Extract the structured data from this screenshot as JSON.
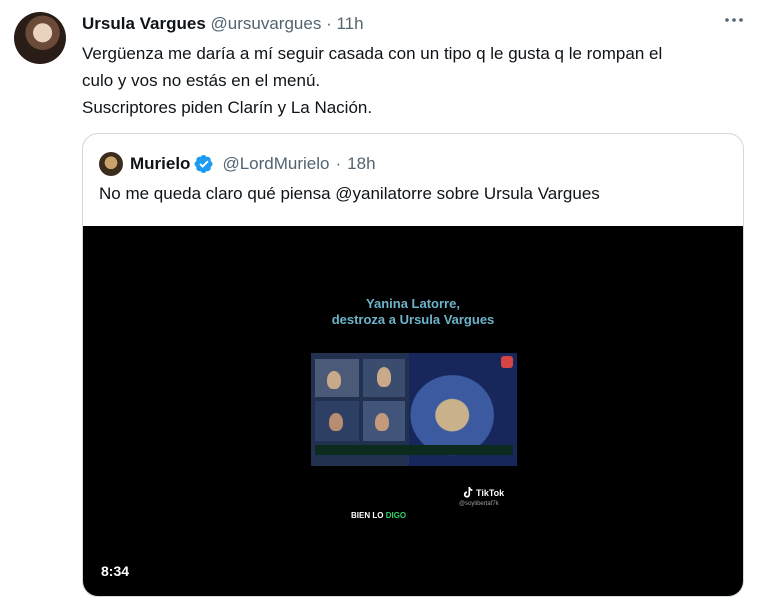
{
  "tweet": {
    "name": "Ursula Vargues",
    "handle": "@ursuvargues",
    "separator": "·",
    "time": "11h",
    "text_lines": [
      "Vergüenza me daría a mí seguir casada con un tipo q le gusta q le rompan el",
      "culo y vos no estás en el menú.",
      "Suscriptores piden Clarín y La Nación."
    ],
    "more_icon": "ellipsis-icon"
  },
  "quote": {
    "name": "Murielo",
    "handle": "@LordMurielo",
    "separator": "·",
    "time": "18h",
    "text": "No me queda claro qué piensa @yanilatorre sobre Ursula Vargues",
    "verified_icon": "verified-badge-icon"
  },
  "video": {
    "title_line1": "Yanina Latorre,",
    "title_line2": "destroza a Ursula Vargues",
    "tiktok_label": "TikTok",
    "tiktok_user": "@soylibertaf7k",
    "bien_lo": "BIEN LO",
    "digo": "DIGO",
    "duration": "8:34"
  },
  "colors": {
    "text": "#0f1419",
    "secondary": "#536471",
    "border": "#cfd9de",
    "verified": "#1d9bf0",
    "video_title": "#6db3c9",
    "green": "#31d36b"
  }
}
